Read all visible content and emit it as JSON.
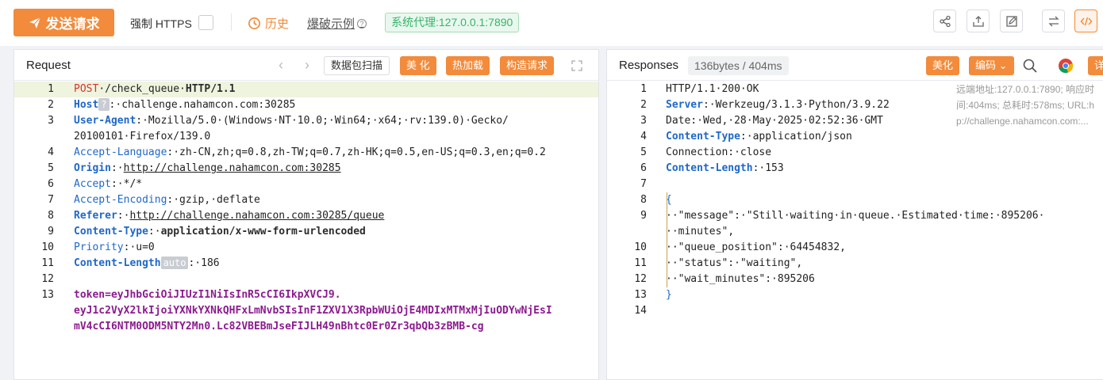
{
  "toolbar": {
    "send_label": "发送请求",
    "https_label": "强制 HTTPS",
    "https_checked": false,
    "history_label": "历史",
    "examples_label": "爆破示例",
    "examples_help": "?",
    "proxy_label": "系统代理:127.0.0.1:7890",
    "icons": [
      "share-icon",
      "upload-icon",
      "edit-icon",
      "swap-icon",
      "code-icon"
    ]
  },
  "request": {
    "title": "Request",
    "nav_prev": "‹",
    "nav_next": "›",
    "scan_label": "数据包扫描",
    "beautify_label": "美 化",
    "hotload_label": "热加载",
    "build_label": "构造请求",
    "lines": [
      {
        "n": "1",
        "parts": [
          [
            "m-post",
            "POST"
          ],
          [
            "",
            "·/check_queue·"
          ],
          [
            "gray-b",
            "HTTP/1.1"
          ]
        ]
      },
      {
        "n": "2",
        "parts": [
          [
            "k",
            "Host"
          ],
          [
            "chip",
            "?"
          ],
          [
            "",
            ":·challenge.nahamcon.com:30285"
          ]
        ]
      },
      {
        "n": "3",
        "parts": [
          [
            "k",
            "User-Agent"
          ],
          [
            "",
            ":·Mozilla/5.0·(Windows·NT·10.0;·Win64;·x64;·rv:139.0)·Gecko/"
          ]
        ]
      },
      {
        "n": "",
        "parts": [
          [
            "",
            "20100101·Firefox/139.0"
          ]
        ]
      },
      {
        "n": "4",
        "parts": [
          [
            "kn",
            "Accept-Language"
          ],
          [
            "",
            ":·zh-CN,zh;q=0.8,zh-TW;q=0.7,zh-HK;q=0.5,en-US;q=0.3,en;q=0.2"
          ]
        ]
      },
      {
        "n": "5",
        "parts": [
          [
            "k",
            "Origin"
          ],
          [
            "",
            ":·"
          ],
          [
            "lnk",
            "http://challenge.nahamcon.com:30285"
          ]
        ]
      },
      {
        "n": "6",
        "parts": [
          [
            "kn",
            "Accept"
          ],
          [
            "",
            ":·*/*"
          ]
        ]
      },
      {
        "n": "7",
        "parts": [
          [
            "kn",
            "Accept-Encoding"
          ],
          [
            "",
            ":·gzip,·deflate"
          ]
        ]
      },
      {
        "n": "8",
        "parts": [
          [
            "k",
            "Referer"
          ],
          [
            "",
            ":·"
          ],
          [
            "lnk",
            "http://challenge.nahamcon.com:30285/queue"
          ]
        ]
      },
      {
        "n": "9",
        "parts": [
          [
            "k",
            "Content-Type"
          ],
          [
            "",
            ":·"
          ],
          [
            "gray-b",
            "application/x-www-form-urlencoded"
          ]
        ]
      },
      {
        "n": "10",
        "parts": [
          [
            "kn",
            "Priority"
          ],
          [
            "",
            ":·u=0"
          ]
        ]
      },
      {
        "n": "11",
        "parts": [
          [
            "k",
            "Content-Length"
          ],
          [
            "chip",
            "auto"
          ],
          [
            "",
            ":·186"
          ]
        ]
      },
      {
        "n": "12",
        "parts": [
          [
            "",
            ""
          ]
        ]
      },
      {
        "n": "13",
        "parts": [
          [
            "tok",
            "token=eyJhbGciOiJIUzI1NiIsInR5cCI6IkpXVCJ9."
          ]
        ]
      },
      {
        "n": "",
        "parts": [
          [
            "tok",
            "eyJ1c2VyX2lkIjoiYXNkYXNkQHFxLmNvbSIsInF1ZXV1X3RpbWUiOjE4MDIxMTMxMjIuODYwNjEsI"
          ]
        ]
      },
      {
        "n": "",
        "parts": [
          [
            "tok",
            "mV4cCI6NTM0ODM5NTY2Mn0.Lc82VBEBmJseFIJLH49nBhtc0Er0Zr3qbQb3zBMB-cg"
          ]
        ]
      }
    ]
  },
  "response": {
    "title": "Responses",
    "meta": "136bytes / 404ms",
    "beautify_label": "美化",
    "encoding_label": "编码",
    "detail_label": "详",
    "side_info": "远端地址:127.0.0.1:7890; 响应时\n间:404ms; 总耗时:578ms; URL:h\np://challenge.nahamcon.com:...",
    "lines": [
      {
        "n": "1",
        "parts": [
          [
            "",
            "HTTP/1.1·200·OK"
          ]
        ]
      },
      {
        "n": "2",
        "parts": [
          [
            "k",
            "Server"
          ],
          [
            "",
            ":·Werkzeug/3.1.3·Python/3.9.22"
          ]
        ]
      },
      {
        "n": "3",
        "parts": [
          [
            "",
            "Date:·Wed,·28·May·2025·02:52:36·GMT"
          ]
        ]
      },
      {
        "n": "4",
        "parts": [
          [
            "k",
            "Content-Type"
          ],
          [
            "",
            ":·application/json"
          ]
        ]
      },
      {
        "n": "5",
        "parts": [
          [
            "",
            "Connection:·close"
          ]
        ]
      },
      {
        "n": "6",
        "parts": [
          [
            "k",
            "Content-Length"
          ],
          [
            "",
            ":·153"
          ]
        ]
      },
      {
        "n": "7",
        "parts": [
          [
            "",
            ""
          ]
        ]
      },
      {
        "n": "8",
        "parts": [
          [
            "kn",
            "{"
          ]
        ]
      },
      {
        "n": "9",
        "parts": [
          [
            "",
            "··\"message\":·\"Still·waiting·in·queue.·Estimated·time:·895206·"
          ]
        ]
      },
      {
        "n": "",
        "parts": [
          [
            "",
            "··minutes\","
          ]
        ]
      },
      {
        "n": "10",
        "parts": [
          [
            "",
            "··\"queue_position\":·64454832,"
          ]
        ]
      },
      {
        "n": "11",
        "parts": [
          [
            "",
            "··\"status\":·\"waiting\","
          ]
        ]
      },
      {
        "n": "12",
        "parts": [
          [
            "",
            "··\"wait_minutes\":·895206"
          ]
        ]
      },
      {
        "n": "13",
        "parts": [
          [
            "kn",
            "}"
          ]
        ]
      },
      {
        "n": "14",
        "parts": [
          [
            "",
            ""
          ]
        ]
      }
    ]
  },
  "colors": {
    "accent": "#f28b3b",
    "proxy_green": "#38b36a",
    "key_blue": "#1f68c9",
    "method_red": "#d6362b",
    "token_purple": "#8b1b8e"
  }
}
